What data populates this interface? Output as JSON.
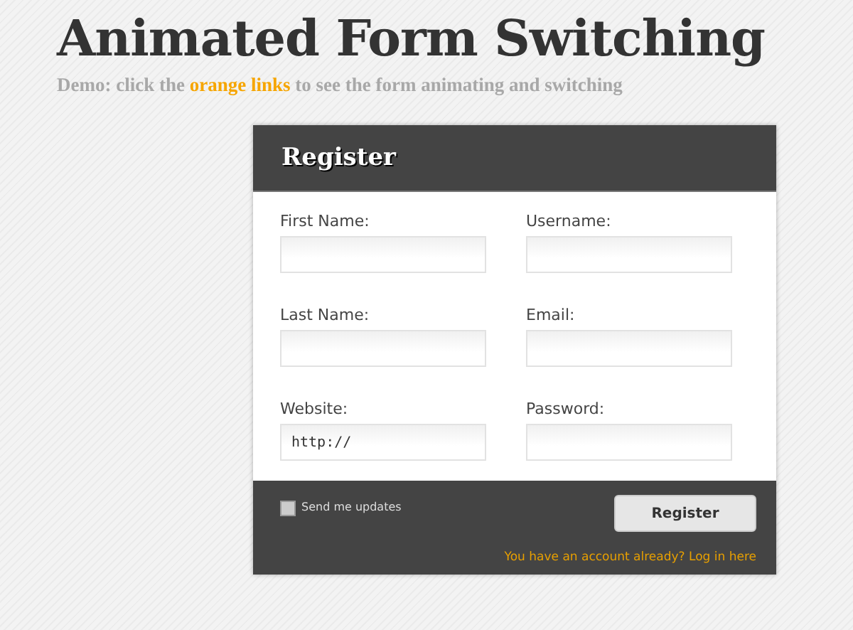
{
  "title": "Animated Form Switching",
  "subtitle": [
    {
      "kind": "plain",
      "text": "Demo: click the "
    },
    {
      "kind": "highlight",
      "text": "orange links"
    },
    {
      "kind": "plain",
      "text": " to see the form animating and switching"
    }
  ],
  "form": {
    "heading": "Register",
    "fields": [
      {
        "label": "First Name:"
      },
      {
        "label": "Username:"
      },
      {
        "label": "Last Name:"
      },
      {
        "label": "Email:"
      },
      {
        "label": "Website:",
        "value": "http://"
      },
      {
        "label": "Password:"
      }
    ],
    "checkbox": {
      "label": "Send me updates",
      "checked": false
    },
    "submit": "Register",
    "switch_link": "You have an account already? Log in here"
  }
}
